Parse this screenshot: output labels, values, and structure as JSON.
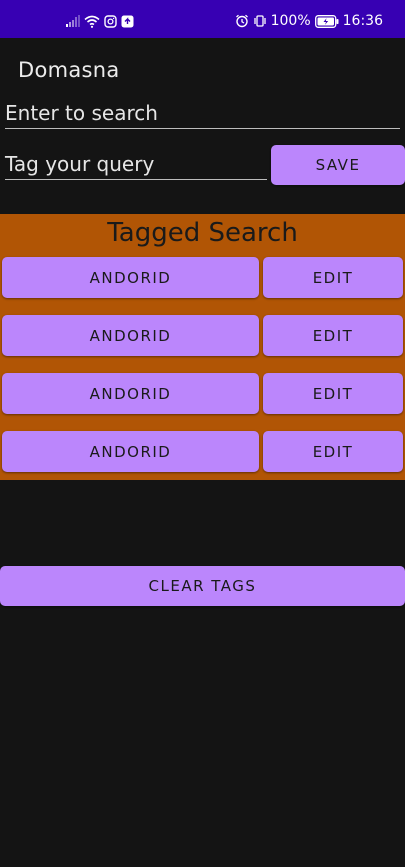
{
  "status_bar": {
    "battery_percent": "100%",
    "time": "16:36"
  },
  "app": {
    "title": "Domasna"
  },
  "search": {
    "query_placeholder": "Enter to search",
    "tag_placeholder": "Tag your query",
    "save_label": "SAVE"
  },
  "tagged": {
    "title": "Tagged Search",
    "items": [
      {
        "tag": "ANDORID",
        "edit_label": "EDIT"
      },
      {
        "tag": "ANDORID",
        "edit_label": "EDIT"
      },
      {
        "tag": "ANDORID",
        "edit_label": "EDIT"
      },
      {
        "tag": "ANDORID",
        "edit_label": "EDIT"
      }
    ]
  },
  "actions": {
    "clear_label": "CLEAR TAGS"
  },
  "colors": {
    "status_bar": "#3700b3",
    "background": "#141414",
    "button": "#bb86fc",
    "panel": "#b15505"
  }
}
